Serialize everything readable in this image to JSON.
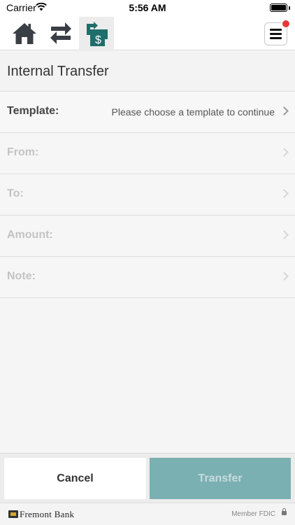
{
  "status_bar": {
    "carrier": "Carrier",
    "time": "5:56 AM",
    "wifi_icon": "wifi-icon",
    "battery_level": 1.0
  },
  "nav": {
    "tabs": [
      {
        "name": "home",
        "icon": "home-icon"
      },
      {
        "name": "transfers",
        "icon": "transfer-arrows-icon"
      },
      {
        "name": "internal-transfer",
        "icon": "internal-transfer-icon",
        "selected": true
      }
    ],
    "menu_icon": "hamburger-menu-icon",
    "notification_badge_color": "#e53935"
  },
  "page": {
    "title": "Internal Transfer"
  },
  "form": {
    "rows": [
      {
        "label": "Template:",
        "value": "Please choose a template to continue",
        "enabled": true
      },
      {
        "label": "From:",
        "value": "",
        "enabled": false
      },
      {
        "label": "To:",
        "value": "",
        "enabled": false
      },
      {
        "label": "Amount:",
        "value": "",
        "enabled": false
      },
      {
        "label": "Note:",
        "value": "",
        "enabled": false
      }
    ]
  },
  "actions": {
    "cancel_label": "Cancel",
    "transfer_label": "Transfer"
  },
  "footer": {
    "bank_name": "Fremont Bank",
    "fdic": "Member FDIC",
    "lock_icon": "lock-icon"
  },
  "colors": {
    "accent": "#1e6e6b",
    "transfer_button": "#7ab0b2"
  }
}
